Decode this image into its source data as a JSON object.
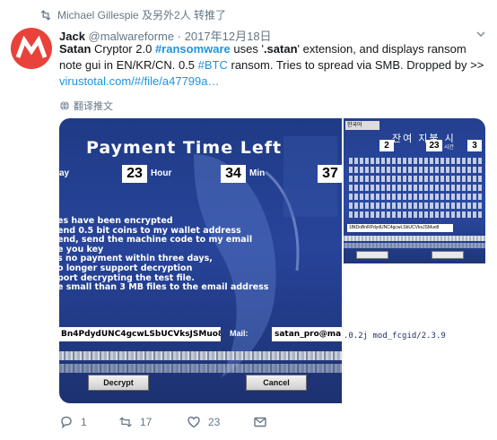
{
  "retweet_banner": {
    "icon": "retweet-icon",
    "text": "Michael Gillespie 及另外2人 转推了"
  },
  "tweet": {
    "author_name": "Jack",
    "author_handle": "@malwareforme",
    "separator": "·",
    "date": "2017年12月18日",
    "text_parts": {
      "p1": "Satan",
      "p2": " Cryptor 2.0 ",
      "p3": "#ransomware",
      "p4": " uses '",
      "p5": ".satan",
      "p6": "' extension, and displays ransom note gui in EN/KR/CN. 0.5 ",
      "p7": "#BTC",
      "p8": " ransom. Tries to spread via SMB. Dropped by >>",
      "p9": "virustotal.com/#/file/a47799a…"
    },
    "translate_label": "翻译推文"
  },
  "ransom_note_main": {
    "title": "Payment Time Left",
    "day_label": "ay",
    "hours_value": "23",
    "hours_label": "Hour",
    "minutes_value": "34",
    "minutes_label": "Min",
    "seconds_value": "37",
    "note_lines": [
      "es have been encrypted",
      "end 0.5 bit coins to my wallet address",
      "end, send the machine code to my email",
      "e you key",
      "s no payment within three days,",
      "o longer support decryption",
      "port decrypting the test file.",
      "e small than 3 MB files to the email address"
    ],
    "machine_code": "Bn4PdydUNC4gcwLSbUCVksJSMuo8",
    "mail_label": "Mail:",
    "mail_value": "satan_pro@mail",
    "decrypt_button": "Decrypt",
    "cancel_button": "Cancel"
  },
  "ransom_note_korean": {
    "language_select": "한국어",
    "title": "잔여 지불 시",
    "day_value": "2",
    "hours_value": "23",
    "hours_label": "시간",
    "minutes_value": "3",
    "machine_code": "1BtDoBnRPdydUNC4gcwLSbUCVksJSMuo8"
  },
  "server_banner": ".0.2j mod_fcgid/2.3.9",
  "actions": {
    "reply_count": "1",
    "retweet_count": "17",
    "like_count": "23"
  },
  "colors": {
    "link": "#1b95e0",
    "muted": "#657786",
    "avatar": "#e8423a",
    "note_bg": "#27449a"
  }
}
